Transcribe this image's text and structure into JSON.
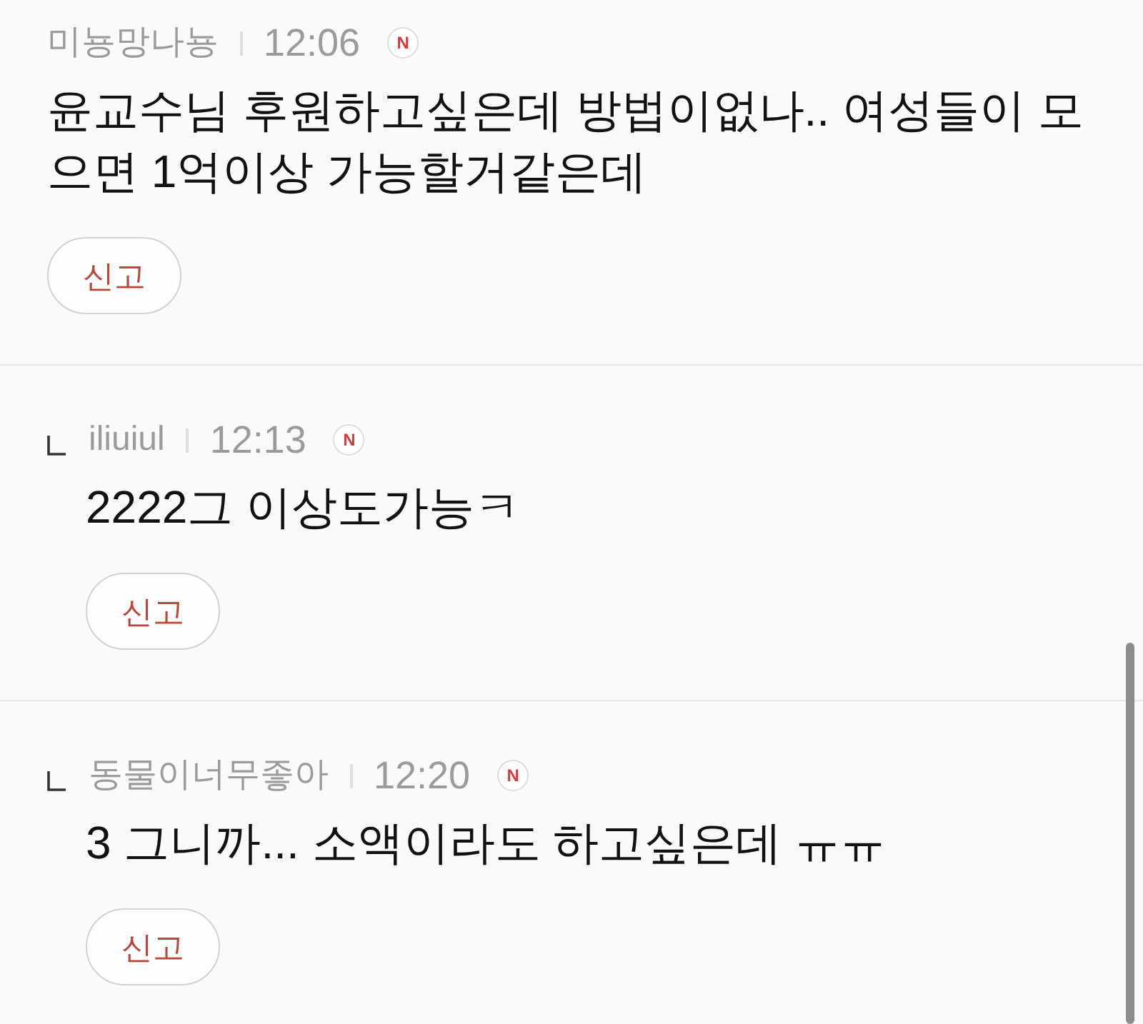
{
  "comments": [
    {
      "kind": "comment",
      "author": "미뇽망나뇽",
      "time": "12:06",
      "badge": "N",
      "text": "윤교수님 후원하고싶은데 방법이없나.. 여성들이 모으면 1억이상 가능할거같은데",
      "report_label": "신고"
    },
    {
      "kind": "reply",
      "author": "iliuiul",
      "time": "12:13",
      "badge": "N",
      "text": "2222그 이상도가능ㅋ",
      "report_label": "신고"
    },
    {
      "kind": "reply",
      "author": "동물이너무좋아",
      "time": "12:20",
      "badge": "N",
      "text": "3 그니까... 소액이라도 하고싶은데 ㅠㅠ",
      "report_label": "신고"
    }
  ]
}
